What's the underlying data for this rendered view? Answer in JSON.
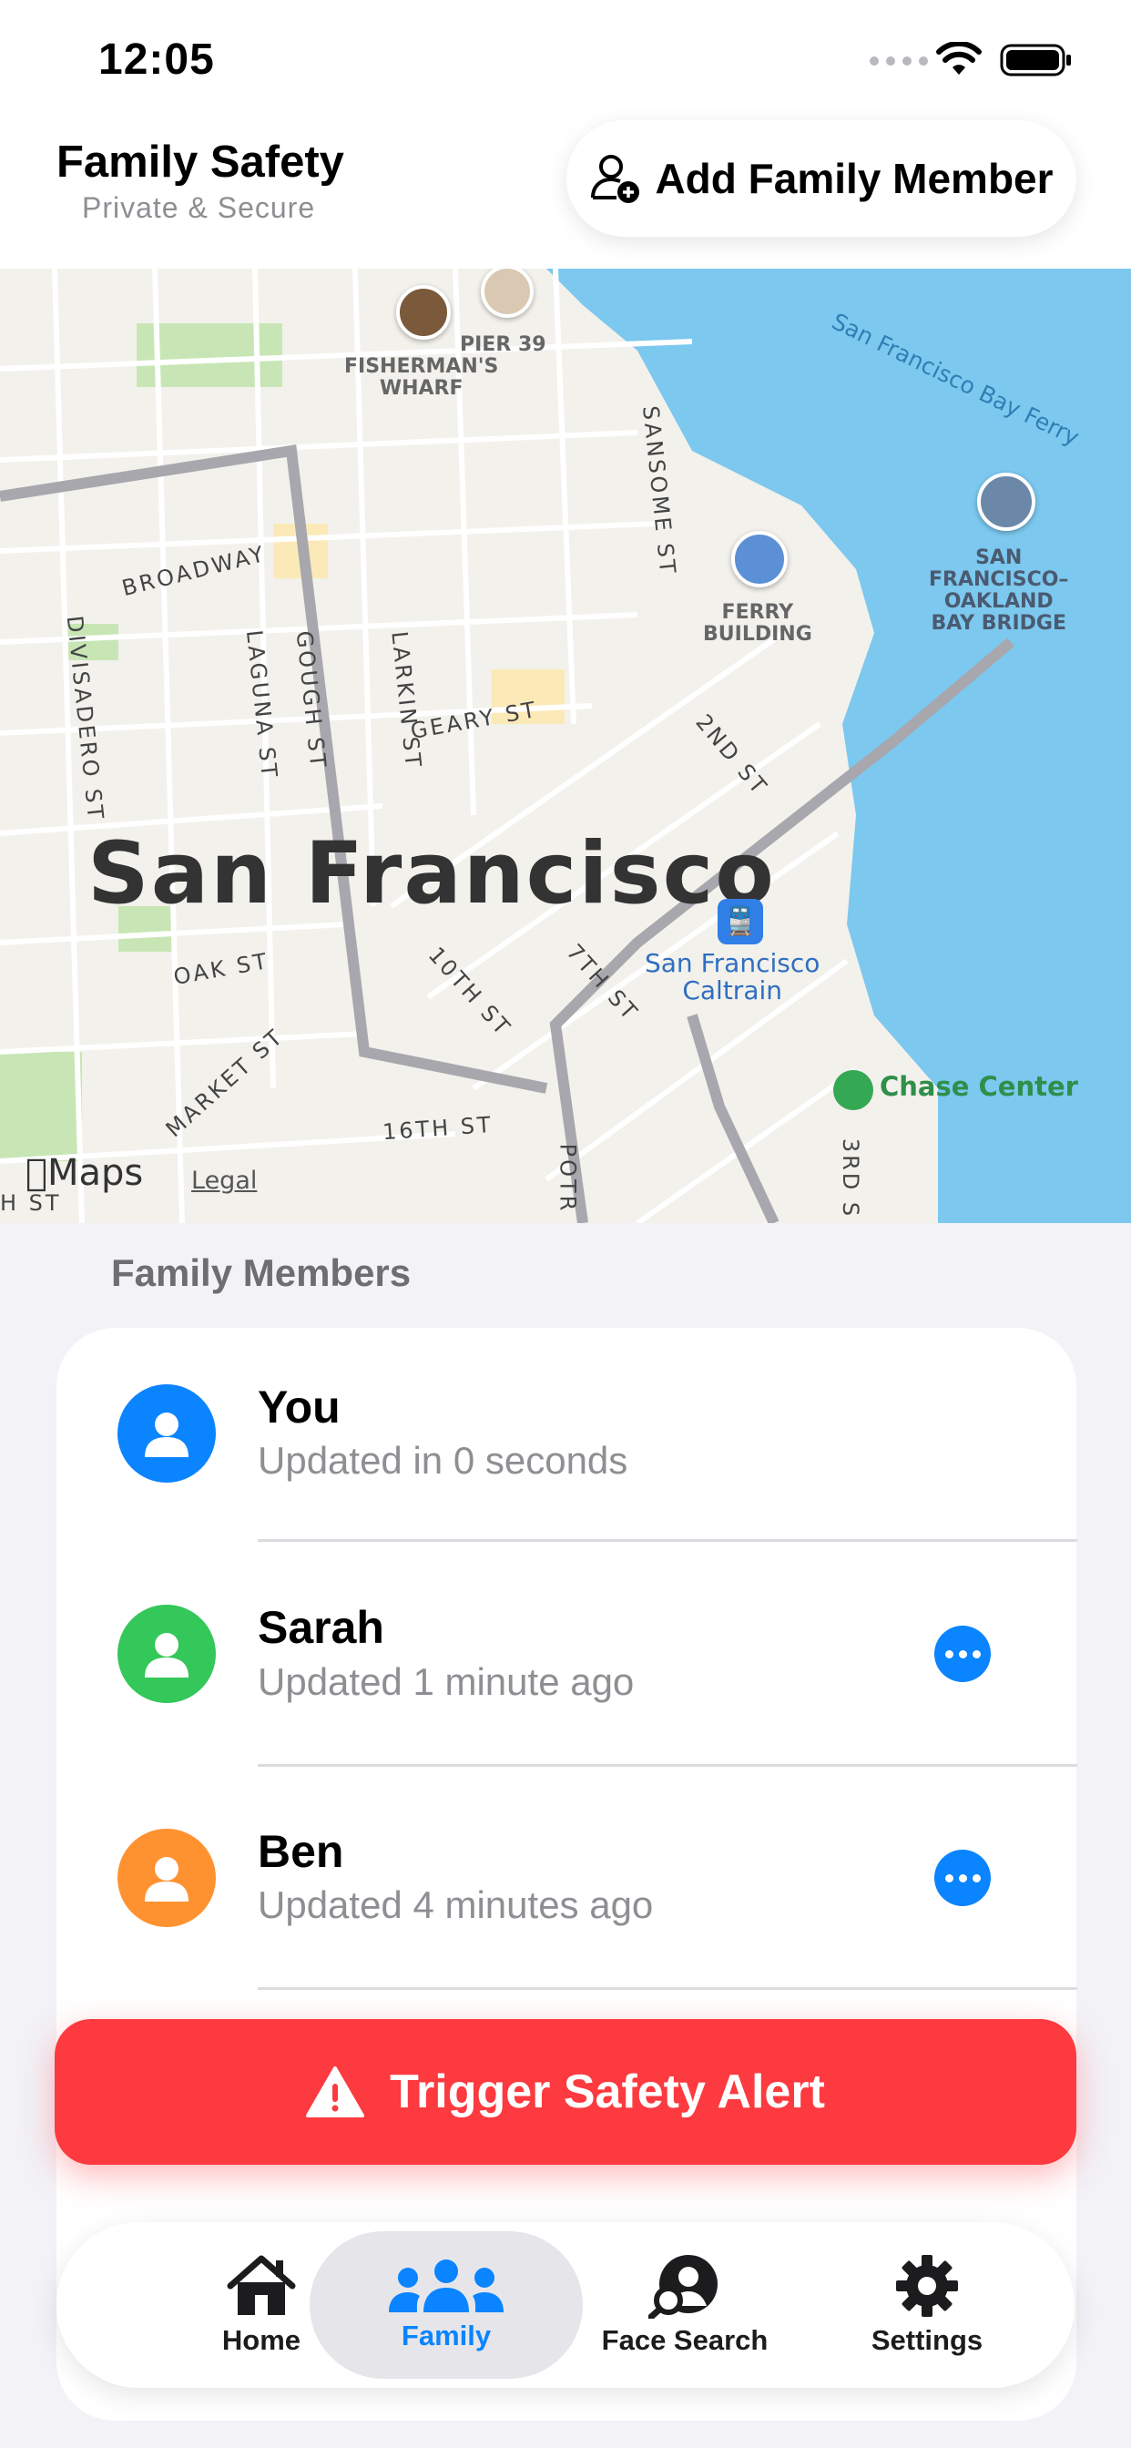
{
  "status_bar": {
    "time": "12:05"
  },
  "header": {
    "title": "Family Safety",
    "subtitle": "Private & Secure",
    "add_member_label": "Add Family Member"
  },
  "map": {
    "city": "San Francisco",
    "attribution": "Maps",
    "legal": "Legal",
    "streets": {
      "broadway": "BROADWAY",
      "divisadero": "DIVISADERO ST",
      "laguna": "LAGUNA ST",
      "gough": "GOUGH ST",
      "larkin": "LARKIN ST",
      "geary": "GEARY ST",
      "sansome": "SANSOME ST",
      "second": "2ND ST",
      "oak": "OAK ST",
      "tenth": "10TH ST",
      "seventh": "7TH ST",
      "market": "MARKET ST",
      "sixteenth": "16TH ST",
      "third": "3RD S",
      "potrero": "POTR",
      "h_st": "H ST"
    },
    "pois": {
      "pier39": "PIER 39",
      "fishermans_wharf": "FISHERMAN'S\nWHARF",
      "ferry_building": "FERRY\nBUILDING",
      "bay_bridge": "SAN\nFRANCISCO–\nOAKLAND\nBAY BRIDGE",
      "ferry": "San Francisco Bay Ferry",
      "caltrain": "San Francisco\nCaltrain",
      "chase_center": "Chase Center"
    }
  },
  "family": {
    "section_title": "Family Members",
    "members": [
      {
        "name": "You",
        "status": "Updated in 0 seconds",
        "color": "#0a84ff"
      },
      {
        "name": "Sarah",
        "status": "Updated 1 minute ago",
        "color": "#34c759"
      },
      {
        "name": "Ben",
        "status": "Updated 4 minutes ago",
        "color": "#ff9230"
      }
    ]
  },
  "alert": {
    "label": "Trigger Safety Alert",
    "color": "#fc3a3f"
  },
  "tabbar": {
    "tabs": [
      {
        "label": "Home",
        "icon": "house-icon"
      },
      {
        "label": "Family",
        "icon": "people-icon",
        "active": true
      },
      {
        "label": "Face Search",
        "icon": "face-search-icon"
      },
      {
        "label": "Settings",
        "icon": "gear-icon"
      }
    ]
  },
  "colors": {
    "accent": "#0a84ff",
    "water": "#7cc8ef"
  }
}
